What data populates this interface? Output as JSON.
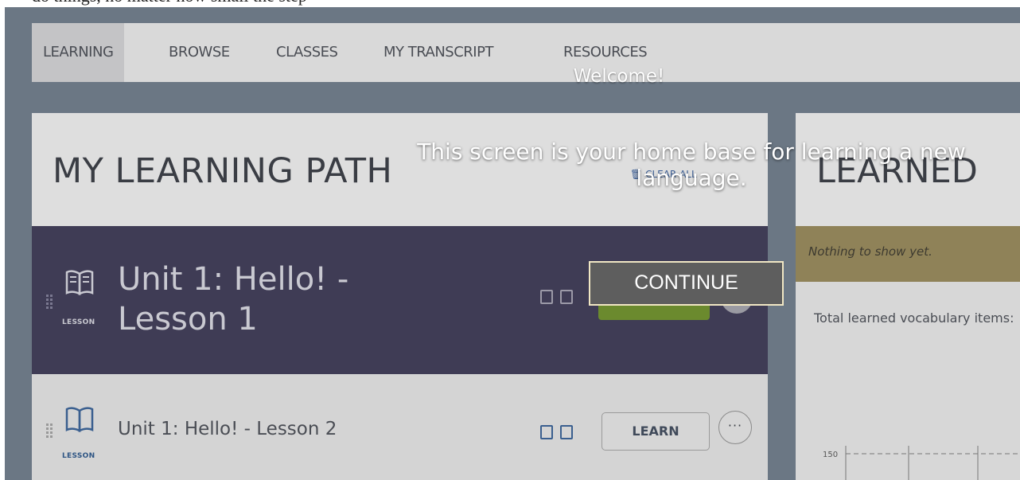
{
  "topstrip": {
    "text": "do things, no matter how small the step"
  },
  "nav": {
    "items": [
      {
        "label": "LEARNING"
      },
      {
        "label": "BROWSE"
      },
      {
        "label": "CLASSES"
      },
      {
        "label": "MY TRANSCRIPT"
      },
      {
        "label": "RESOURCES"
      }
    ]
  },
  "learning_path": {
    "title": "MY LEARNING PATH",
    "clear_all": "CLEAR ALL",
    "lessons": [
      {
        "tag": "LESSON",
        "title": "Unit 1: Hello! - Lesson 1"
      },
      {
        "tag": "LESSON",
        "title": "Unit 1: Hello! - Lesson 2",
        "button": "LEARN",
        "more": "···"
      }
    ]
  },
  "learned": {
    "title": "LEARNED",
    "notice": "Nothing to show yet.",
    "total_label": "Total learned vocabulary items:",
    "chart_tick": "150"
  },
  "overlay": {
    "title": "Welcome!",
    "message": "This screen is your home base for learning a new language.",
    "continue": "CONTINUE"
  },
  "colors": {
    "dim_background": "#6b7784",
    "active_lesson": "#3f3c55",
    "notice": "#8f8258",
    "continue_border": "#f1e7c4"
  }
}
